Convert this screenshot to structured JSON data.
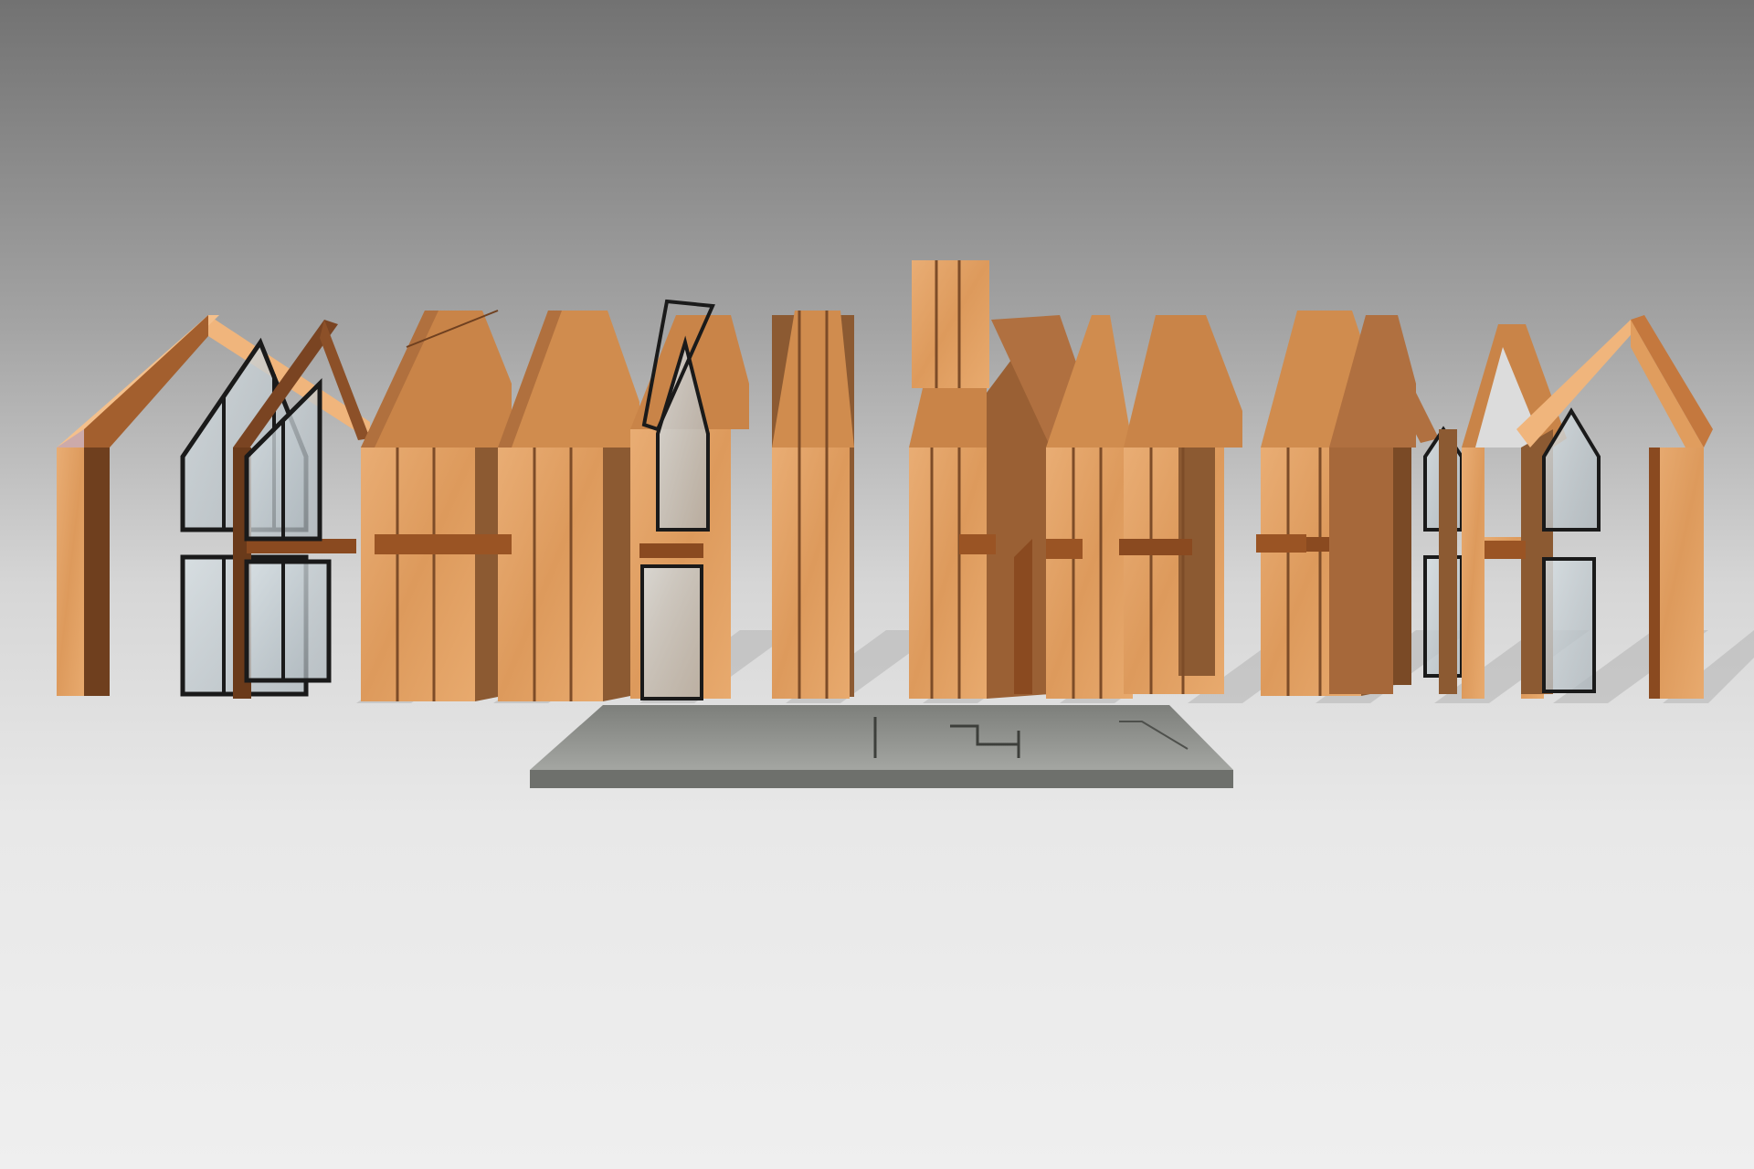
{
  "image": {
    "subject": "exploded-axonometric-timber-house",
    "colors": {
      "sky_top": "#7a7a7a",
      "sky_mid": "#b8b8b8",
      "ground": "#ebebeb",
      "wood_light": "#e6a66b",
      "wood_mid": "#d08a4e",
      "wood_dark": "#7a4a26",
      "wood_edge": "#a0643a",
      "glass": "#c9d3d8",
      "window_frame": "#1d1d1d",
      "slab_top": "#8f918c",
      "slab_side": "#6c6e6a",
      "shadow": "#a9a9a9",
      "beam": "#8a4a20"
    }
  }
}
